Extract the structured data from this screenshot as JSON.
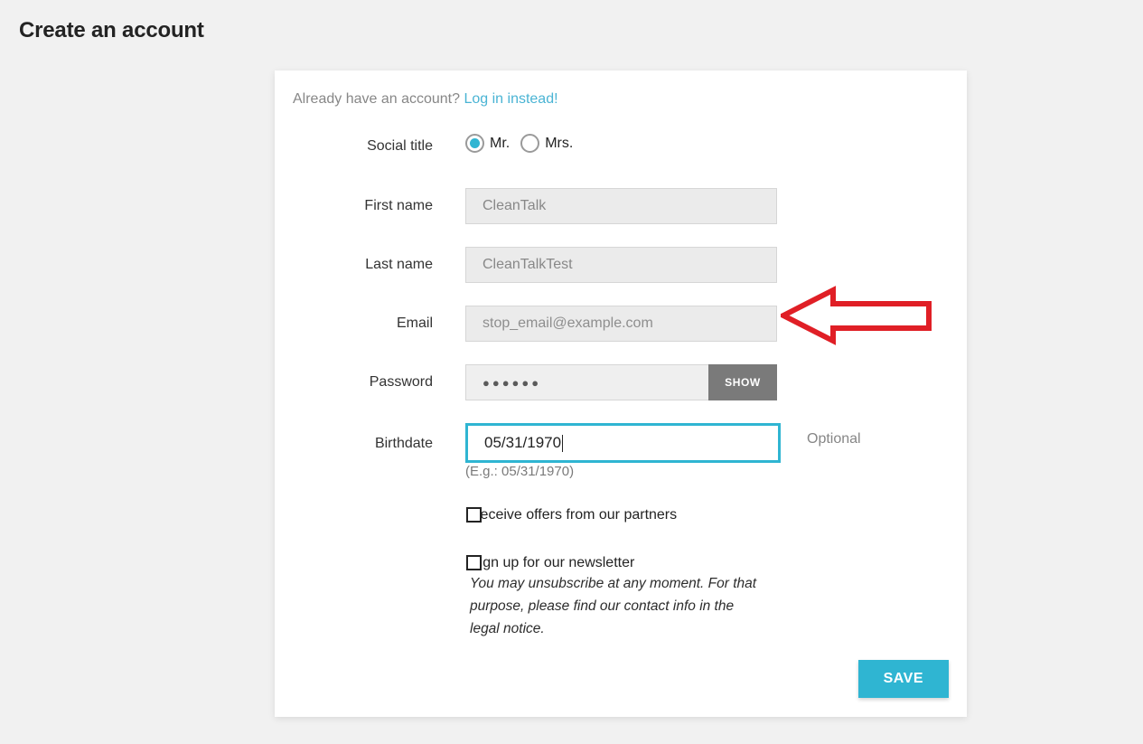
{
  "page": {
    "title": "Create an account",
    "background_color": "#f1f1f1"
  },
  "card": {
    "already_text": "Already have an account?",
    "login_link": "Log in instead!"
  },
  "form": {
    "social_title": {
      "label": "Social title",
      "options": [
        {
          "label": "Mr.",
          "selected": true
        },
        {
          "label": "Mrs.",
          "selected": false
        }
      ]
    },
    "first_name": {
      "label": "First name",
      "value": "CleanTalk",
      "placeholder": "First name"
    },
    "last_name": {
      "label": "Last name",
      "value": "CleanTalkTest",
      "placeholder": "Last name"
    },
    "email": {
      "label": "Email",
      "value": "stop_email@example.com",
      "placeholder": "Email"
    },
    "password": {
      "label": "Password",
      "masked_value": "●●●●●●",
      "show_button": "SHOW"
    },
    "birthdate": {
      "label": "Birthdate",
      "value": "05/31/1970",
      "hint": "(E.g.: 05/31/1970)",
      "optional_text": "Optional"
    },
    "partners_offer": {
      "label": "Receive offers from our partners",
      "checked": false
    },
    "newsletter": {
      "label": "Sign up for our newsletter",
      "description": "You may unsubscribe at any moment. For that purpose, please find our contact info in the legal notice.",
      "checked": false
    },
    "save_button": "SAVE"
  },
  "annotation": {
    "arrow": "left-arrow-annotation",
    "color": "#e01f26"
  },
  "colors": {
    "accent": "#2fb5d2",
    "link": "#4ab4d4",
    "show_button": "#7a7a7a",
    "input_bg": "#ebebeb",
    "annotation_red": "#e01f26"
  }
}
